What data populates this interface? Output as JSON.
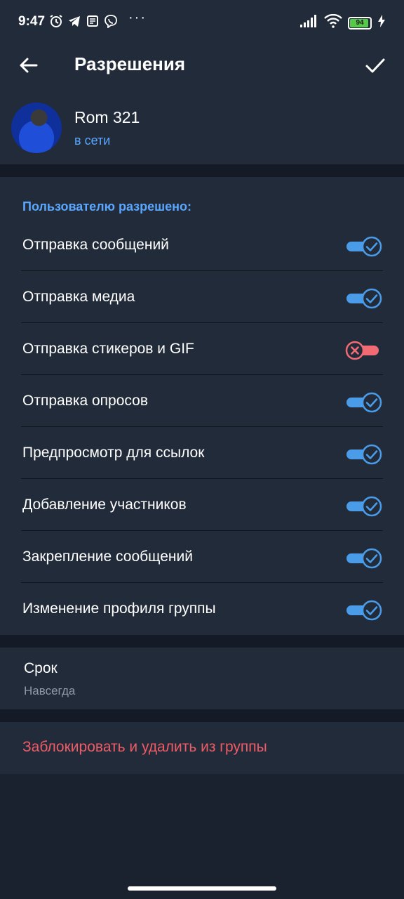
{
  "status_bar": {
    "time": "9:47",
    "left_icons": [
      "alarm-icon",
      "telegram-icon",
      "news-icon",
      "viber-icon"
    ],
    "more_dots": "···",
    "battery_level": "94",
    "battery_percent": 94
  },
  "header": {
    "title": "Разрешения",
    "back_icon": "arrow-left-icon",
    "confirm_icon": "check-icon"
  },
  "user": {
    "name": "Rom 321",
    "status": "в сети"
  },
  "permissions": {
    "header": "Пользователю разрешено:",
    "items": [
      {
        "label": "Отправка сообщений",
        "enabled": true
      },
      {
        "label": "Отправка медиа",
        "enabled": true
      },
      {
        "label": "Отправка стикеров и GIF",
        "enabled": false
      },
      {
        "label": "Отправка опросов",
        "enabled": true
      },
      {
        "label": "Предпросмотр для ссылок",
        "enabled": true
      },
      {
        "label": "Добавление участников",
        "enabled": true
      },
      {
        "label": "Закрепление сообщений",
        "enabled": true
      },
      {
        "label": "Изменение профиля группы",
        "enabled": true
      }
    ]
  },
  "term": {
    "title": "Срок",
    "value": "Навсегда"
  },
  "ban": {
    "label": "Заблокировать и удалить из группы"
  },
  "colors": {
    "accent": "#5aa7ff",
    "toggle_on": "#4a9be8",
    "toggle_off": "#f06b74",
    "danger": "#ef5b67",
    "surface": "#222b39",
    "background": "#1a2230"
  }
}
